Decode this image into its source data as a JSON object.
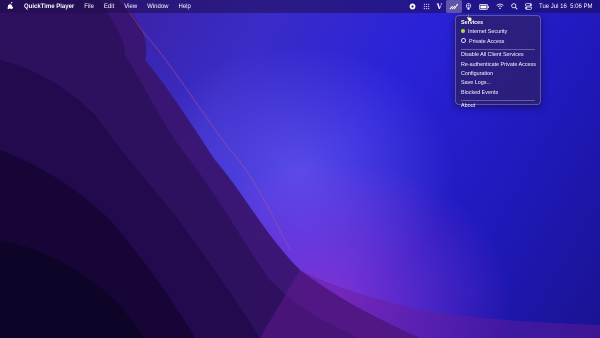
{
  "menubar": {
    "app_name": "QuickTime Player",
    "menus": [
      "File",
      "Edit",
      "View",
      "Window",
      "Help"
    ],
    "clock": "Tue Jul 16  5:06 PM"
  },
  "status_icons": [
    "control-circle-icon",
    "grid-dots-icon",
    "v-app-icon",
    "tools-icon",
    "lock-globe-icon",
    "battery-icon",
    "wifi-icon",
    "search-icon",
    "control-center-icon"
  ],
  "dropdown": {
    "header": "Services",
    "services": [
      {
        "label": "Internet Security",
        "status": "on"
      },
      {
        "label": "Private Access",
        "status": "off"
      }
    ],
    "actions": [
      "Disable All Client Services",
      "Re-authenticate Private Access",
      "Configuration",
      "Save Logs...",
      "Blocked Events"
    ],
    "about": "About"
  },
  "colors": {
    "status_on": "#9ad94a",
    "menubar": "#1e0c50"
  }
}
